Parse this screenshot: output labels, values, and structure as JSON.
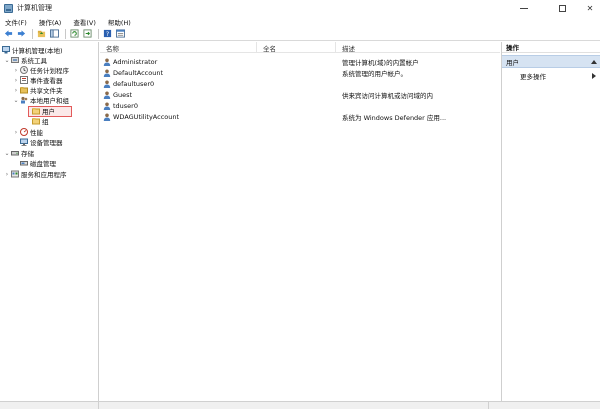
{
  "window": {
    "title": "计算机管理"
  },
  "menu": [
    "文件(F)",
    "操作(A)",
    "查看(V)",
    "帮助(H)"
  ],
  "toolbar": [
    "back-icon",
    "forward-icon",
    "up-folder-icon",
    "show-hide-tree-icon",
    "refresh-icon",
    "export-icon",
    "help-icon",
    "properties-icon"
  ],
  "tree": [
    {
      "label": "计算机管理(本地)",
      "icon": "computer-management-icon",
      "chevron": ""
    },
    {
      "label": "系统工具",
      "icon": "tools-icon",
      "chevron": "⌄"
    },
    {
      "label": "任务计划程序",
      "icon": "clock-icon",
      "chevron": "›"
    },
    {
      "label": "事件查看器",
      "icon": "event-viewer-icon",
      "chevron": "›"
    },
    {
      "label": "共享文件夹",
      "icon": "shared-folder-icon",
      "chevron": "›"
    },
    {
      "label": "本地用户和组",
      "icon": "users-groups-icon",
      "chevron": "⌄"
    },
    {
      "label": "用户",
      "icon": "folder-icon",
      "chevron": ""
    },
    {
      "label": "组",
      "icon": "folder-icon",
      "chevron": ""
    },
    {
      "label": "性能",
      "icon": "performance-icon",
      "chevron": "›"
    },
    {
      "label": "设备管理器",
      "icon": "device-manager-icon",
      "chevron": ""
    },
    {
      "label": "存储",
      "icon": "storage-icon",
      "chevron": "⌄"
    },
    {
      "label": "磁盘管理",
      "icon": "disk-management-icon",
      "chevron": ""
    },
    {
      "label": "服务和应用程序",
      "icon": "services-icon",
      "chevron": "›"
    }
  ],
  "list": {
    "columns": [
      "名称",
      "全名",
      "描述"
    ],
    "rows": [
      {
        "name": "Administrator",
        "fullname": "",
        "description": "管理计算机(域)的内置帐户"
      },
      {
        "name": "DefaultAccount",
        "fullname": "",
        "description": "系统管理的用户帐户。"
      },
      {
        "name": "defaultuser0",
        "fullname": "",
        "description": ""
      },
      {
        "name": "Guest",
        "fullname": "",
        "description": "供来宾访问计算机或访问域的内"
      },
      {
        "name": "tduser0",
        "fullname": "",
        "description": ""
      },
      {
        "name": "WDAGUtilityAccount",
        "fullname": "",
        "description": "系统为 Windows Defender 应用..."
      }
    ]
  },
  "actions": {
    "header": "操作",
    "section": "用户",
    "items": [
      "更多操作"
    ]
  },
  "colors": {
    "selection_border": "#e35a5a",
    "section_bg": "#d6e3f2"
  }
}
